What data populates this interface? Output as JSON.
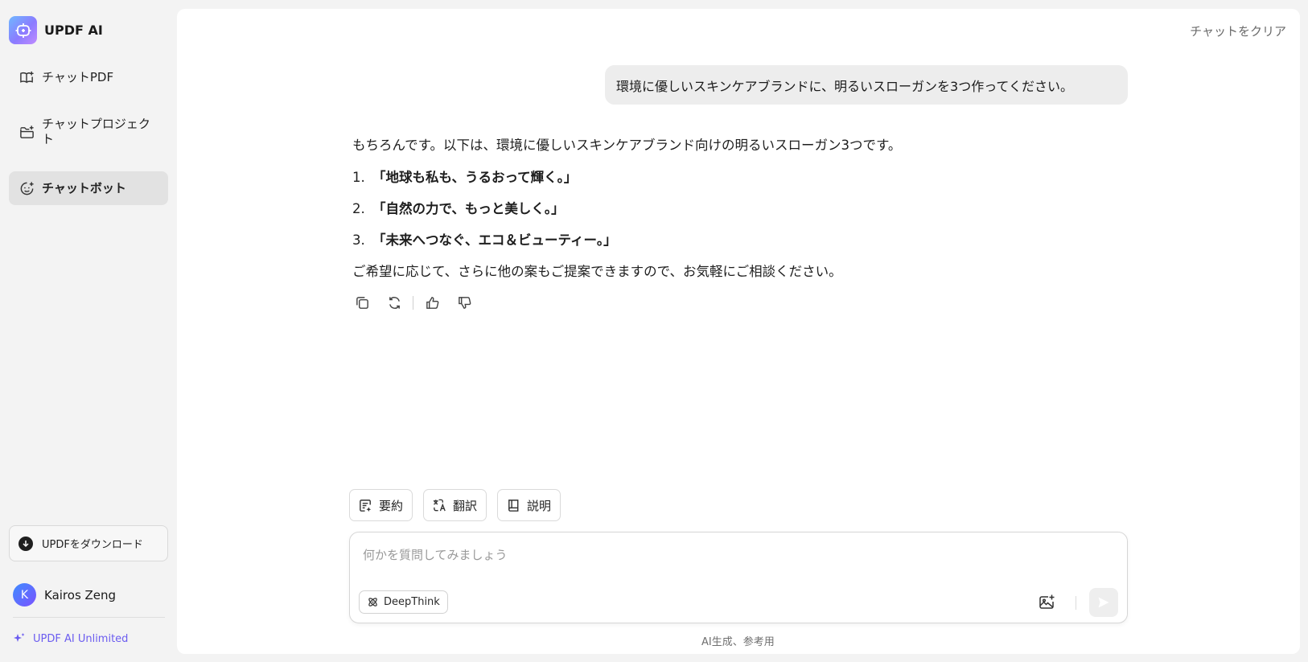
{
  "sidebar": {
    "brand": "UPDF AI",
    "items": [
      {
        "label": "チャットPDF",
        "icon": "book-icon"
      },
      {
        "label": "チャットプロジェクト",
        "icon": "folder-icon"
      },
      {
        "label": "チャットボット",
        "icon": "bot-icon"
      }
    ],
    "download_label": "UPDFをダウンロード",
    "user": {
      "initial": "K",
      "name": "Kairos Zeng"
    },
    "plan_label": "UPDF AI Unlimited"
  },
  "header": {
    "clear_label": "チャットをクリア"
  },
  "chat": {
    "user_message": "環境に優しいスキンケアブランドに、明るいスローガンを3つ作ってください。",
    "answer": {
      "intro": "もちろんです。以下は、環境に優しいスキンケアブランド向けの明るいスローガン3つです。",
      "items": [
        {
          "num": "1.",
          "text": "「地球も私も、うるおって輝く。」"
        },
        {
          "num": "2.",
          "text": "「自然の力で、もっと美しく。」"
        },
        {
          "num": "3.",
          "text": "「未来へつなぐ、エコ＆ビューティー。」"
        }
      ],
      "outro": "ご希望に応じて、さらに他の案もご提案できますので、お気軽にご相談ください。"
    }
  },
  "quick_actions": [
    {
      "label": "要約",
      "icon": "summary-icon"
    },
    {
      "label": "翻訳",
      "icon": "translate-icon"
    },
    {
      "label": "説明",
      "icon": "explain-book-icon"
    }
  ],
  "composer": {
    "placeholder": "何かを質問してみましょう",
    "value": "",
    "deepthink_label": "DeepThink"
  },
  "footer_note": "AI生成、参考用"
}
